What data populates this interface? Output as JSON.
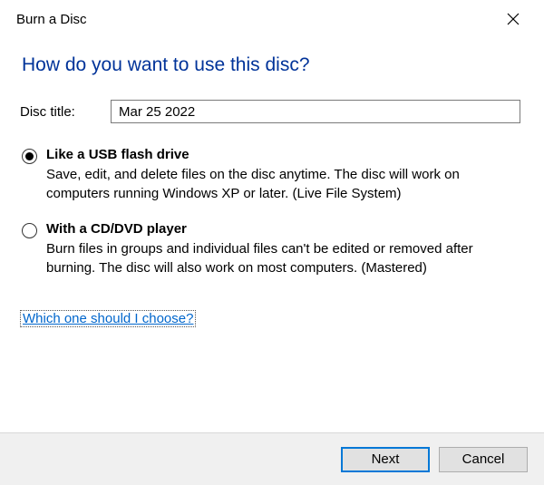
{
  "window": {
    "title": "Burn a Disc"
  },
  "heading": "How do you want to use this disc?",
  "disc_title": {
    "label": "Disc title:",
    "value": "Mar 25 2022"
  },
  "options": [
    {
      "title": "Like a USB flash drive",
      "desc": "Save, edit, and delete files on the disc anytime. The disc will work on computers running Windows XP or later. (Live File System)",
      "selected": true
    },
    {
      "title": "With a CD/DVD player",
      "desc": "Burn files in groups and individual files can't be edited or removed after burning. The disc will also work on most computers. (Mastered)",
      "selected": false
    }
  ],
  "help_link": "Which one should I choose?",
  "buttons": {
    "next": "Next",
    "cancel": "Cancel"
  }
}
